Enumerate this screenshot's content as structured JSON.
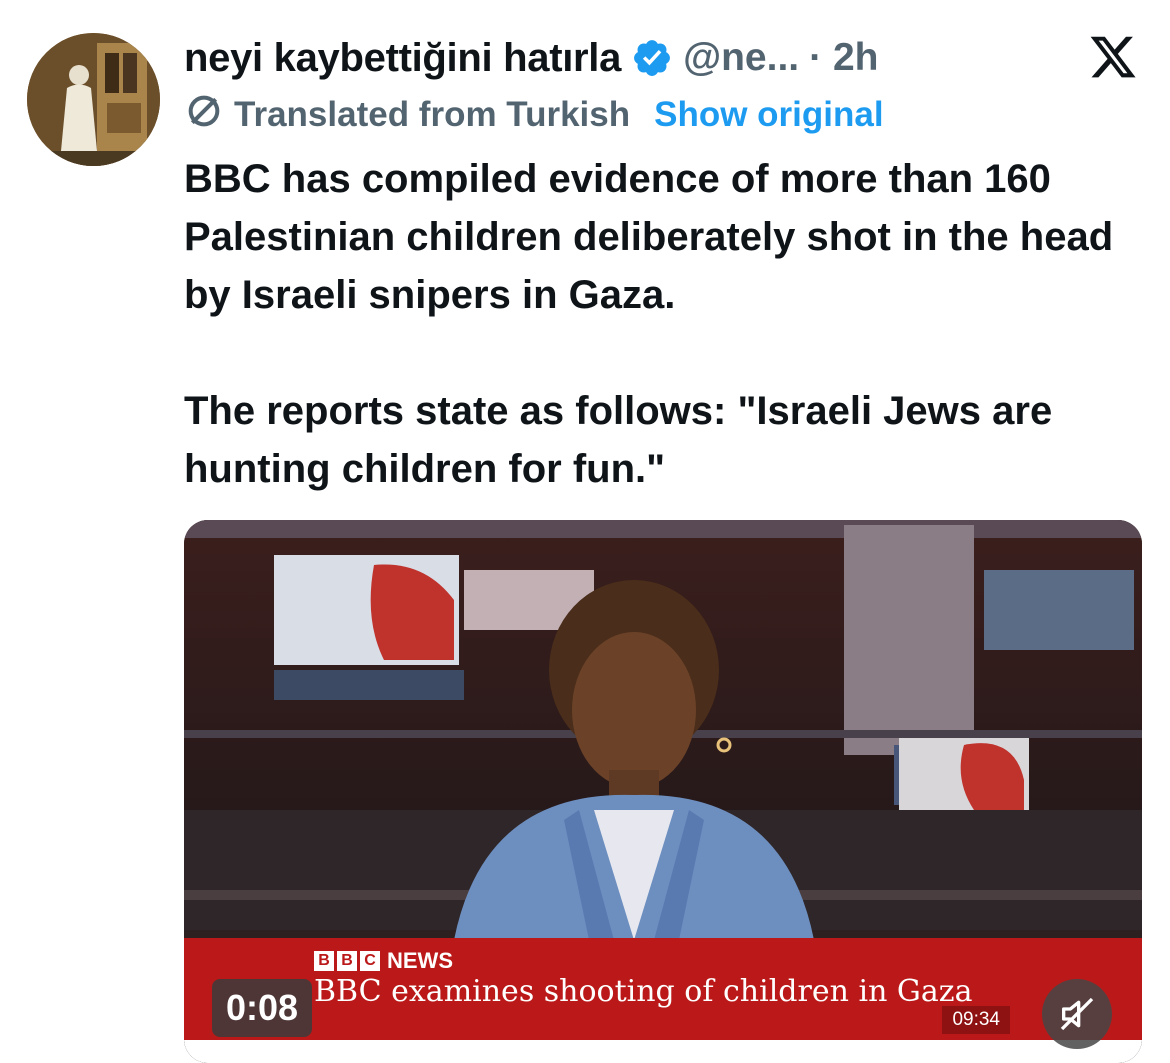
{
  "tweet": {
    "display_name": "neyi kaybettiğini hatırla",
    "handle": "@ne...",
    "separator_time": "· 2h",
    "translated_label": "Translated from Turkish",
    "show_original": "Show original",
    "text": "BBC has compiled evidence of more than 160 Palestinian children deliberately shot in the head by Israeli snipers in Gaza.\n\nThe reports state as follows: \"Israeli Jews are hunting children for fun.\""
  },
  "video": {
    "brand_letters": [
      "B",
      "B",
      "C"
    ],
    "brand_word": "NEWS",
    "headline": "BBC examines shooting of children in Gaza",
    "clock": "09:34",
    "duration": "0:08"
  },
  "icons": {
    "verified": "verified-badge-icon",
    "translate": "globe-icon",
    "logo": "x-logo-icon",
    "mute": "speaker-muted-icon"
  },
  "colors": {
    "accent": "#1d9bf0",
    "secondary_text": "#536471",
    "primary_text": "#0f1419",
    "bbc_red": "#bb1919"
  }
}
